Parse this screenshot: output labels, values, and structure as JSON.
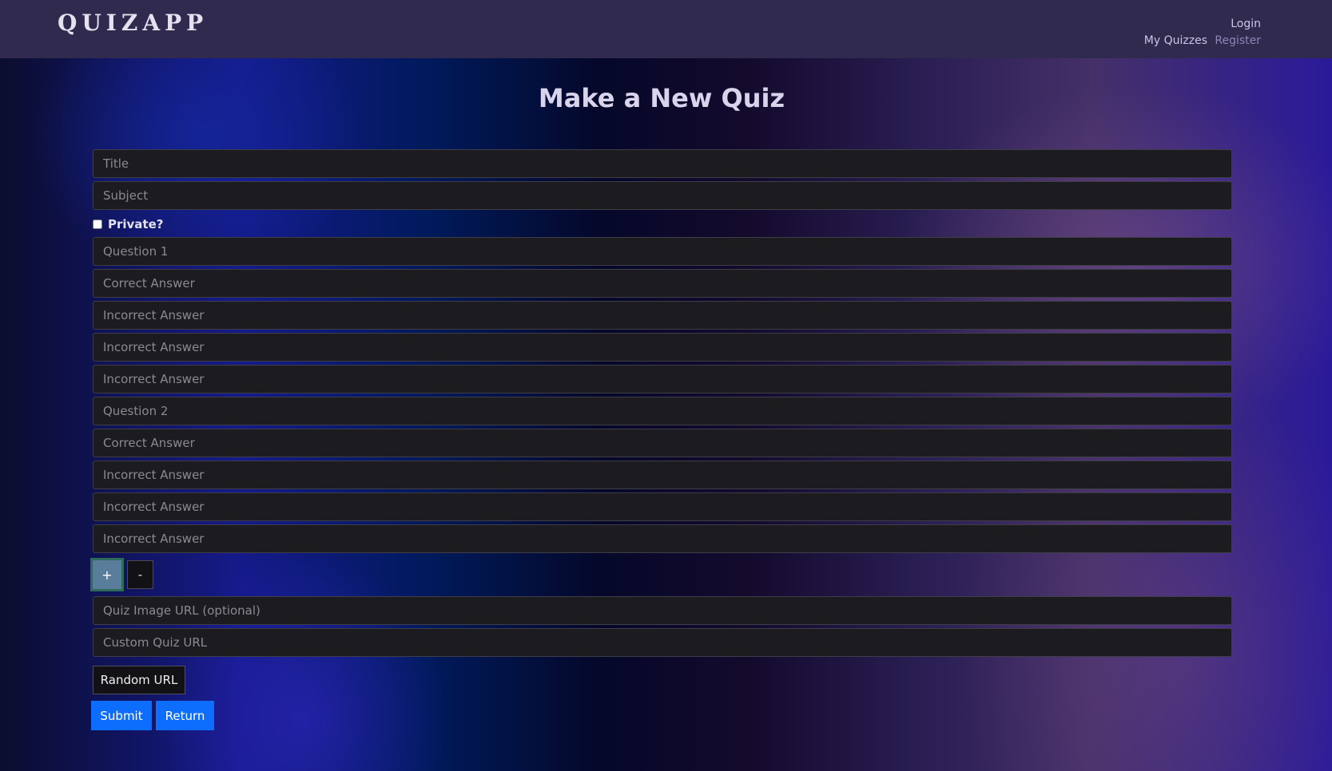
{
  "navbar": {
    "brand": "QUIZAPP",
    "links": {
      "login": "Login",
      "my_quizzes": "My Quizzes",
      "register": "Register"
    }
  },
  "page": {
    "title": "Make a New Quiz"
  },
  "form": {
    "title_placeholder": "Title",
    "subject_placeholder": "Subject",
    "private_label": "Private?",
    "private_checked": false,
    "questions": [
      {
        "question_placeholder": "Question 1",
        "correct_placeholder": "Correct Answer",
        "incorrect_placeholders": [
          "Incorrect Answer",
          "Incorrect Answer",
          "Incorrect Answer"
        ]
      },
      {
        "question_placeholder": "Question 2",
        "correct_placeholder": "Correct Answer",
        "incorrect_placeholders": [
          "Incorrect Answer",
          "Incorrect Answer",
          "Incorrect Answer"
        ]
      }
    ],
    "add_question_label": "+",
    "remove_question_label": "-",
    "image_url_placeholder": "Quiz Image URL (optional)",
    "custom_url_placeholder": "Custom Quiz URL",
    "random_url_label": "Random URL",
    "submit_label": "Submit",
    "return_label": "Return"
  },
  "colors": {
    "navbar_bg": "#2f2a4e",
    "field_bg": "#1c1b1f",
    "primary": "#0d6efd",
    "plus_button": "#5a7d9c"
  }
}
